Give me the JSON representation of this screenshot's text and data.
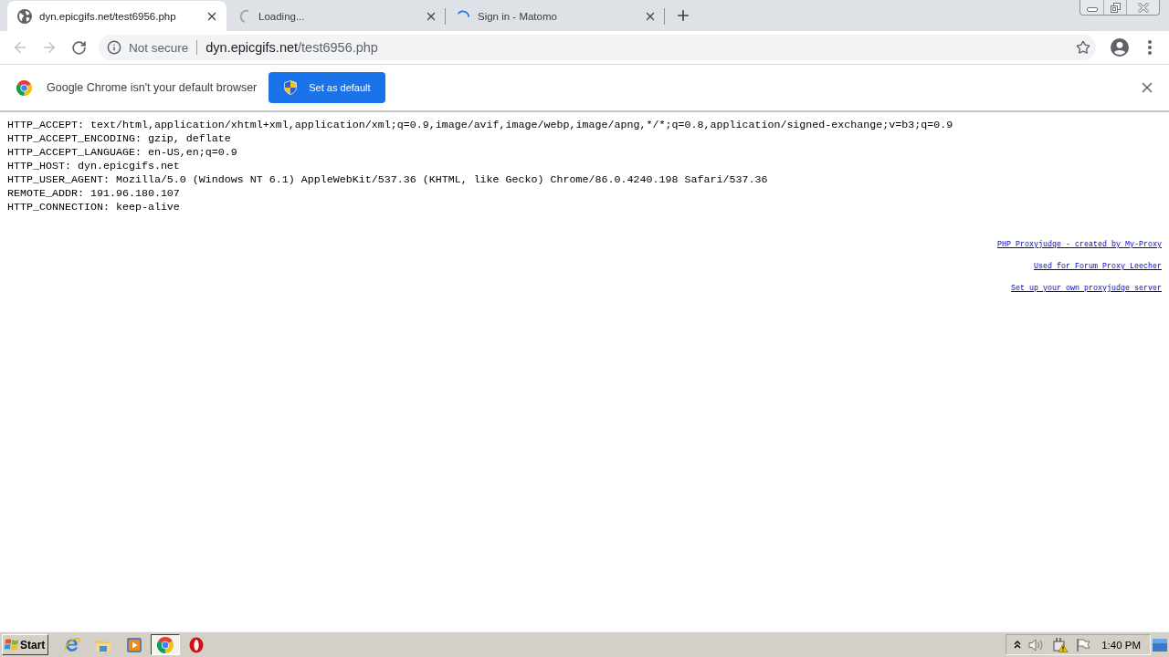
{
  "tabs": [
    {
      "title": "dyn.epicgifs.net/test6956.php",
      "selected": true,
      "kind": "page"
    },
    {
      "title": "Loading...",
      "selected": false,
      "kind": "waiting"
    },
    {
      "title": "Sign in - Matomo",
      "selected": false,
      "kind": "loading"
    }
  ],
  "toolbar": {
    "nav": [
      {
        "kind": "back",
        "disabled": true
      },
      {
        "kind": "forward",
        "disabled": true
      },
      {
        "kind": "reload",
        "disabled": false
      }
    ],
    "address": {
      "security": "Not secure",
      "host": "dyn.epicgifs.net",
      "path": "/test6956.php"
    }
  },
  "infobar": {
    "message": "Google Chrome isn't your default browser",
    "button": "Set as default"
  },
  "page": {
    "lines": [
      "HTTP_ACCEPT: text/html,application/xhtml+xml,application/xml;q=0.9,image/avif,image/webp,image/apng,*/*;q=0.8,application/signed-exchange;v=b3;q=0.9",
      "HTTP_ACCEPT_ENCODING: gzip, deflate",
      "HTTP_ACCEPT_LANGUAGE: en-US,en;q=0.9",
      "HTTP_HOST: dyn.epicgifs.net",
      "HTTP_USER_AGENT: Mozilla/5.0 (Windows NT 6.1) AppleWebKit/537.36 (KHTML, like Gecko) Chrome/86.0.4240.198 Safari/537.36",
      "REMOTE_ADDR: 191.96.180.107",
      "HTTP_CONNECTION: keep-alive"
    ],
    "links": [
      "PHP Proxyjudge - created by My-Proxy",
      "Used for Forum Proxy Leecher",
      "Set up your own proxyjudge server"
    ]
  },
  "taskbar": {
    "start": "Start",
    "apps": [
      {
        "kind": "ie",
        "selected": false
      },
      {
        "kind": "folder",
        "selected": false
      },
      {
        "kind": "media",
        "selected": false
      },
      {
        "kind": "chrome",
        "selected": true
      },
      {
        "kind": "opera",
        "selected": false
      }
    ],
    "clock": "1:40 PM"
  }
}
